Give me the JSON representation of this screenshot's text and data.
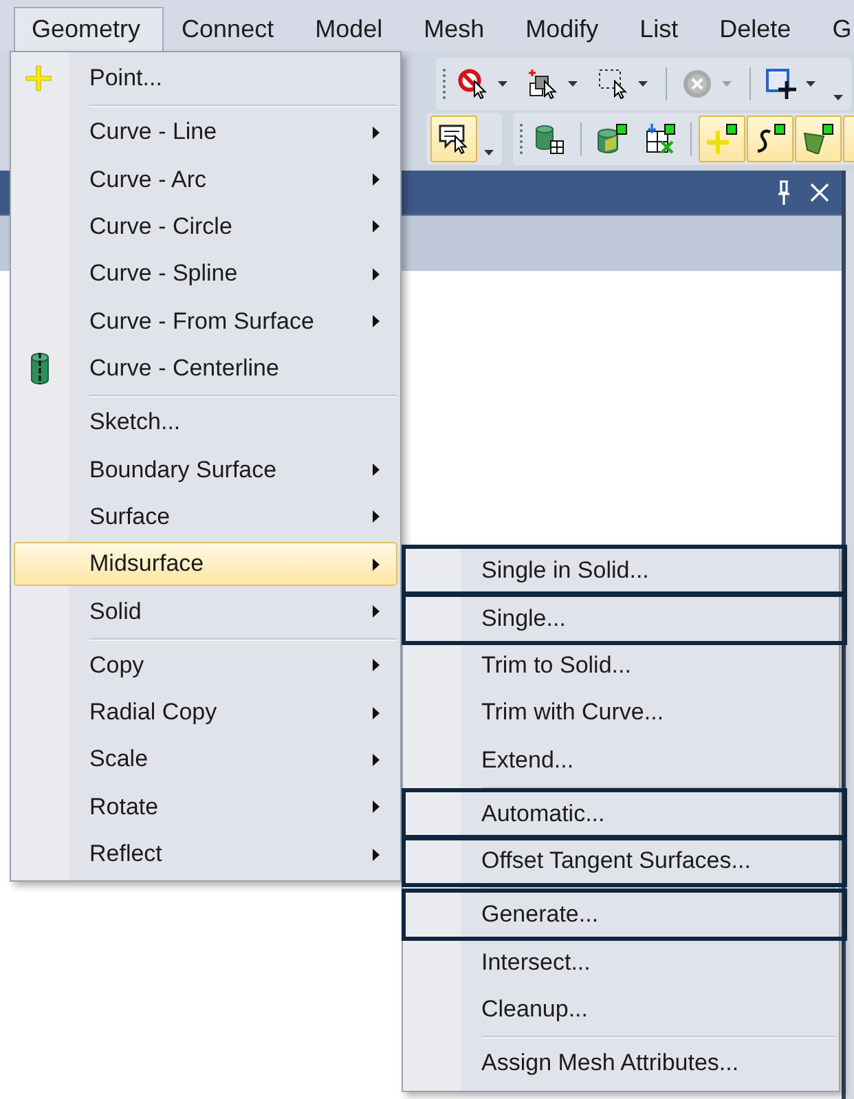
{
  "menu_bar": {
    "items": [
      {
        "label": "Geometry",
        "selected": true
      },
      {
        "label": "Connect",
        "selected": false
      },
      {
        "label": "Model",
        "selected": false
      },
      {
        "label": "Mesh",
        "selected": false
      },
      {
        "label": "Modify",
        "selected": false
      },
      {
        "label": "List",
        "selected": false
      },
      {
        "label": "Delete",
        "selected": false
      },
      {
        "label": "G",
        "selected": false
      }
    ]
  },
  "toolbar_rows": [
    {
      "groups": [
        {
          "items": [
            {
              "kind": "grip"
            },
            {
              "kind": "button",
              "on": false,
              "dropdown": true,
              "disabled": false
            },
            {
              "kind": "button",
              "on": false,
              "dropdown": true,
              "disabled": false
            },
            {
              "kind": "button",
              "on": false,
              "dropdown": true,
              "disabled": false
            },
            {
              "kind": "separator"
            },
            {
              "kind": "button",
              "on": false,
              "dropdown": true,
              "disabled": true
            },
            {
              "kind": "separator"
            },
            {
              "kind": "button",
              "on": false,
              "dropdown": true,
              "disabled": false
            },
            {
              "kind": "overflow"
            }
          ]
        }
      ]
    },
    {
      "groups": [
        {
          "items": [
            {
              "kind": "button",
              "on": true,
              "dropdown": false,
              "disabled": false
            },
            {
              "kind": "overflow"
            }
          ]
        },
        {
          "items": [
            {
              "kind": "grip"
            },
            {
              "kind": "button",
              "on": false,
              "dropdown": false,
              "disabled": false
            },
            {
              "kind": "separator"
            },
            {
              "kind": "button",
              "on": false,
              "dropdown": false,
              "disabled": false
            },
            {
              "kind": "button",
              "on": false,
              "dropdown": false,
              "disabled": false
            },
            {
              "kind": "separator"
            },
            {
              "kind": "button",
              "on": true,
              "dropdown": false,
              "disabled": false
            },
            {
              "kind": "button",
              "on": true,
              "dropdown": false,
              "disabled": false
            },
            {
              "kind": "button",
              "on": true,
              "dropdown": false,
              "disabled": false
            },
            {
              "kind": "button",
              "on": true,
              "dropdown": false,
              "disabled": false
            }
          ]
        }
      ]
    }
  ],
  "geometry_menu": {
    "sections": [
      {
        "items": [
          {
            "label": "Point...",
            "submenu": false,
            "selected": false
          }
        ]
      },
      {
        "items": [
          {
            "label": "Curve - Line",
            "submenu": true,
            "selected": false
          },
          {
            "label": "Curve - Arc",
            "submenu": true,
            "selected": false
          },
          {
            "label": "Curve - Circle",
            "submenu": true,
            "selected": false
          },
          {
            "label": "Curve - Spline",
            "submenu": true,
            "selected": false
          },
          {
            "label": "Curve - From Surface",
            "submenu": true,
            "selected": false
          },
          {
            "label": "Curve - Centerline",
            "submenu": false,
            "selected": false
          }
        ]
      },
      {
        "items": [
          {
            "label": "Sketch...",
            "submenu": false,
            "selected": false
          },
          {
            "label": "Boundary Surface",
            "submenu": true,
            "selected": false
          },
          {
            "label": "Surface",
            "submenu": true,
            "selected": false
          },
          {
            "label": "Midsurface",
            "submenu": true,
            "selected": true
          },
          {
            "label": "Solid",
            "submenu": true,
            "selected": false
          }
        ]
      },
      {
        "items": [
          {
            "label": "Copy",
            "submenu": true,
            "selected": false
          },
          {
            "label": "Radial Copy",
            "submenu": true,
            "selected": false
          },
          {
            "label": "Scale",
            "submenu": true,
            "selected": false
          },
          {
            "label": "Rotate",
            "submenu": true,
            "selected": false
          },
          {
            "label": "Reflect",
            "submenu": true,
            "selected": false
          }
        ]
      }
    ]
  },
  "midsurface_submenu": {
    "sections": [
      {
        "items": [
          {
            "label": "Single in Solid...",
            "selected": false,
            "outlined": true
          },
          {
            "label": "Single...",
            "selected": false,
            "outlined": true
          },
          {
            "label": "Trim to Solid...",
            "selected": false,
            "outlined": false
          },
          {
            "label": "Trim with Curve...",
            "selected": false,
            "outlined": false
          },
          {
            "label": "Extend...",
            "selected": false,
            "outlined": false
          }
        ]
      },
      {
        "items": [
          {
            "label": "Automatic...",
            "selected": false,
            "outlined": true
          },
          {
            "label": "Offset Tangent Surfaces...",
            "selected": false,
            "outlined": true
          }
        ]
      },
      {
        "items": [
          {
            "label": "Generate...",
            "selected": false,
            "outlined": true
          },
          {
            "label": "Intersect...",
            "selected": false,
            "outlined": false
          },
          {
            "label": "Cleanup...",
            "selected": false,
            "outlined": false
          }
        ]
      },
      {
        "items": [
          {
            "label": "Assign Mesh Attributes...",
            "selected": false,
            "outlined": false
          }
        ]
      }
    ]
  }
}
